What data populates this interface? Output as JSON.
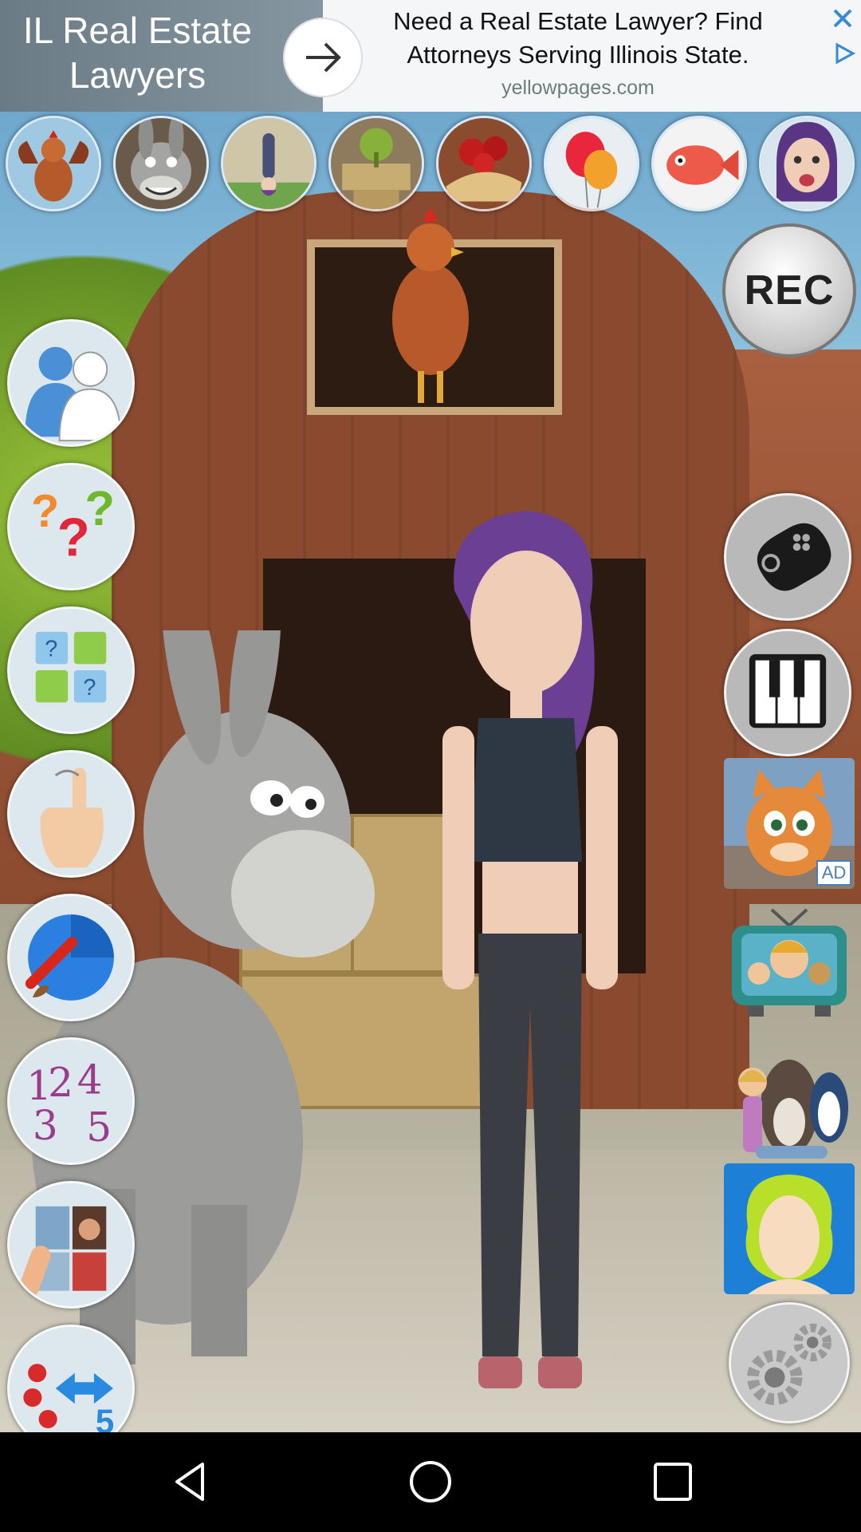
{
  "ad": {
    "left_title": "IL Real Estate Lawyers",
    "headline": "Need a Real Estate Lawyer? Find Attorneys Serving Illinois State.",
    "source": "yellowpages.com"
  },
  "top_buttons": [
    {
      "icon": "rooster-icon"
    },
    {
      "icon": "donkey-icon"
    },
    {
      "icon": "girl-handstand-icon"
    },
    {
      "icon": "plant-hay-icon"
    },
    {
      "icon": "tomato-bread-icon"
    },
    {
      "icon": "balloons-icon"
    },
    {
      "icon": "fish-icon"
    },
    {
      "icon": "girl-face-icon"
    }
  ],
  "left_buttons": [
    {
      "icon": "friends-icon"
    },
    {
      "icon": "questions-icon"
    },
    {
      "icon": "memory-game-icon"
    },
    {
      "icon": "tap-hand-icon"
    },
    {
      "icon": "paint-brush-icon"
    },
    {
      "icon": "numbers-icon"
    },
    {
      "icon": "puzzle-photo-icon"
    },
    {
      "icon": "fruit-count-icon"
    }
  ],
  "right": {
    "rec_label": "REC",
    "ad_badge": "AD"
  },
  "colors": {
    "ad_bg": "#f4f6f8",
    "ad_left_bg": "#7a8a94",
    "barn": "#8a4a30",
    "sky": "#8bc0dc"
  }
}
